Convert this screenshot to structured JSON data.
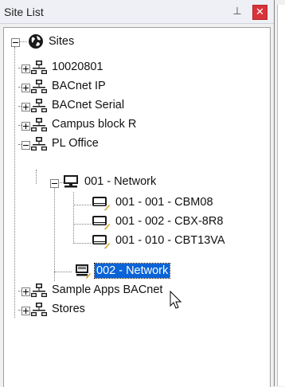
{
  "panel": {
    "title": "Site List",
    "pin_glyph": "⊥",
    "close_glyph": "✕"
  },
  "tree": {
    "root": {
      "label": "Sites",
      "icon": "globe-icon",
      "expanded": true
    },
    "sites": [
      {
        "label": "10020801",
        "icon": "site-network-icon",
        "expanded": false
      },
      {
        "label": "BACnet IP",
        "icon": "site-network-icon",
        "expanded": false
      },
      {
        "label": "BACnet Serial",
        "icon": "site-network-icon",
        "expanded": false
      },
      {
        "label": "Campus block R",
        "icon": "site-network-icon",
        "expanded": false
      },
      {
        "label": "PL Office",
        "icon": "site-network-icon",
        "expanded": true,
        "networks": [
          {
            "label": "001 - Network",
            "icon": "network-computer-icon",
            "expanded": true,
            "devices": [
              {
                "label": "001 - 001 - CBM08",
                "icon": "device-controller-icon"
              },
              {
                "label": "001 - 002 - CBX-8R8",
                "icon": "device-controller-icon"
              },
              {
                "label": "001 - 010 - CBT13VA",
                "icon": "device-controller-icon"
              }
            ]
          },
          {
            "label": "002 - Network",
            "icon": "network-computer-icon",
            "selected": true
          }
        ]
      },
      {
        "label": "Sample Apps BACnet",
        "icon": "site-network-icon",
        "expanded": false
      },
      {
        "label": "Stores",
        "icon": "site-network-icon",
        "expanded": false
      }
    ]
  },
  "colors": {
    "selection": "#0a64d8",
    "close_button": "#d9333a"
  }
}
